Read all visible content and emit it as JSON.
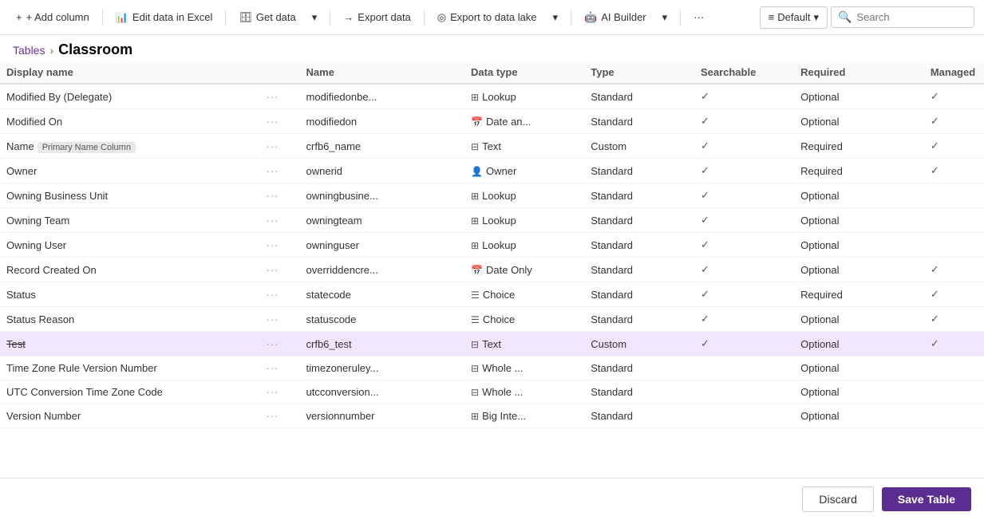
{
  "toolbar": {
    "add_column": "+ Add column",
    "edit_excel": "Edit data in Excel",
    "get_data": "Get data",
    "export_data": "Export data",
    "export_lake": "Export to data lake",
    "ai_builder": "AI Builder",
    "more": "···",
    "default_label": "Default",
    "search_placeholder": "Search"
  },
  "breadcrumb": {
    "tables": "Tables",
    "separator": "›",
    "current": "Classroom"
  },
  "columns": {
    "headers": [
      "Display name",
      "",
      "Name",
      "Data type",
      "Type",
      "Searchable",
      "Required",
      "Managed"
    ]
  },
  "rows": [
    {
      "name": "Modified By (Delegate)",
      "dots": "···",
      "logical": "modifiedonbe...",
      "type_icon": "⊞",
      "type_label": "Lookup",
      "custom": "Standard",
      "searchable": true,
      "required": "Optional",
      "managed": true,
      "selected": false,
      "strikethrough": false,
      "primary": false
    },
    {
      "name": "Modified On",
      "dots": "···",
      "logical": "modifiedon",
      "type_icon": "📅",
      "type_label": "Date an...",
      "custom": "Standard",
      "searchable": true,
      "required": "Optional",
      "managed": true,
      "selected": false,
      "strikethrough": false,
      "primary": false
    },
    {
      "name": "Name",
      "dots": "···",
      "logical": "crfb6_name",
      "type_icon": "⊟",
      "type_label": "Text",
      "custom": "Custom",
      "searchable": true,
      "required": "Required",
      "managed": true,
      "selected": false,
      "strikethrough": false,
      "primary": true
    },
    {
      "name": "Owner",
      "dots": "···",
      "logical": "ownerid",
      "type_icon": "👤",
      "type_label": "Owner",
      "custom": "Standard",
      "searchable": true,
      "required": "Required",
      "managed": true,
      "selected": false,
      "strikethrough": false,
      "primary": false
    },
    {
      "name": "Owning Business Unit",
      "dots": "···",
      "logical": "owningbusine...",
      "type_icon": "⊞",
      "type_label": "Lookup",
      "custom": "Standard",
      "searchable": true,
      "required": "Optional",
      "managed": false,
      "selected": false,
      "strikethrough": false,
      "primary": false
    },
    {
      "name": "Owning Team",
      "dots": "···",
      "logical": "owningteam",
      "type_icon": "⊞",
      "type_label": "Lookup",
      "custom": "Standard",
      "searchable": true,
      "required": "Optional",
      "managed": false,
      "selected": false,
      "strikethrough": false,
      "primary": false
    },
    {
      "name": "Owning User",
      "dots": "···",
      "logical": "owninguser",
      "type_icon": "⊞",
      "type_label": "Lookup",
      "custom": "Standard",
      "searchable": true,
      "required": "Optional",
      "managed": false,
      "selected": false,
      "strikethrough": false,
      "primary": false
    },
    {
      "name": "Record Created On",
      "dots": "···",
      "logical": "overriddencre...",
      "type_icon": "📅",
      "type_label": "Date Only",
      "custom": "Standard",
      "searchable": true,
      "required": "Optional",
      "managed": true,
      "selected": false,
      "strikethrough": false,
      "primary": false
    },
    {
      "name": "Status",
      "dots": "···",
      "logical": "statecode",
      "type_icon": "☰",
      "type_label": "Choice",
      "custom": "Standard",
      "searchable": true,
      "required": "Required",
      "managed": true,
      "selected": false,
      "strikethrough": false,
      "primary": false
    },
    {
      "name": "Status Reason",
      "dots": "···",
      "logical": "statuscode",
      "type_icon": "☰",
      "type_label": "Choice",
      "custom": "Standard",
      "searchable": true,
      "required": "Optional",
      "managed": true,
      "selected": false,
      "strikethrough": false,
      "primary": false
    },
    {
      "name": "Test",
      "dots": "···",
      "logical": "crfb6_test",
      "type_icon": "⊟",
      "type_label": "Text",
      "custom": "Custom",
      "searchable": true,
      "required": "Optional",
      "managed": true,
      "selected": true,
      "strikethrough": true,
      "primary": false
    },
    {
      "name": "Time Zone Rule Version Number",
      "dots": "···",
      "logical": "timezoneruley...",
      "type_icon": "⊟",
      "type_label": "Whole ...",
      "custom": "Standard",
      "searchable": false,
      "required": "Optional",
      "managed": false,
      "selected": false,
      "strikethrough": false,
      "primary": false
    },
    {
      "name": "UTC Conversion Time Zone Code",
      "dots": "···",
      "logical": "utcconversion...",
      "type_icon": "⊟",
      "type_label": "Whole ...",
      "custom": "Standard",
      "searchable": false,
      "required": "Optional",
      "managed": false,
      "selected": false,
      "strikethrough": false,
      "primary": false
    },
    {
      "name": "Version Number",
      "dots": "···",
      "logical": "versionnumber",
      "type_icon": "⊞",
      "type_label": "Big Inte...",
      "custom": "Standard",
      "searchable": false,
      "required": "Optional",
      "managed": false,
      "selected": false,
      "strikethrough": false,
      "primary": false
    }
  ],
  "footer": {
    "discard": "Discard",
    "save": "Save Table"
  },
  "badge": {
    "primary_name": "Primary Name Column"
  }
}
